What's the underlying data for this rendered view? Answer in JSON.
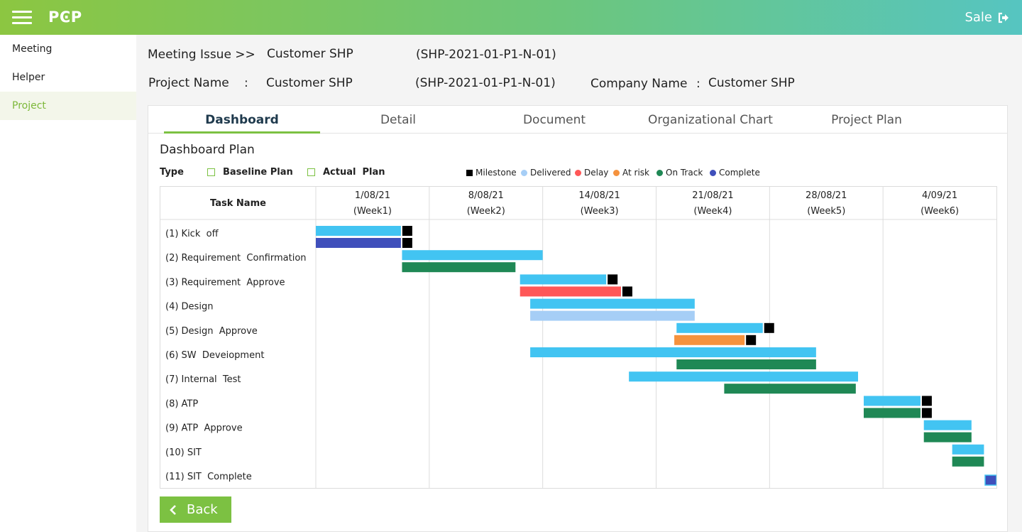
{
  "header": {
    "logo": "PϾP",
    "user_label": "Sale",
    "logout_icon": "logout-icon",
    "menu_icon": "hamburger-icon"
  },
  "sidebar": {
    "items": [
      {
        "label": "Meeting"
      },
      {
        "label": "Helper"
      },
      {
        "label": "Project",
        "active": true
      }
    ]
  },
  "meeting": {
    "prefix": "Meeting Issue >>",
    "name": "Customer SHP",
    "code": "(SHP-2021-01-P1-N-01)"
  },
  "project": {
    "label": "Project Name",
    "sep": ":",
    "name": "Customer SHP",
    "code": "(SHP-2021-01-P1-N-01)",
    "company_label": "Company Name",
    "company_sep": ":",
    "company": "Customer SHP"
  },
  "tabs": [
    {
      "label": "Dashboard",
      "active": true
    },
    {
      "label": "Detail"
    },
    {
      "label": "Document"
    },
    {
      "label": "Organizational Chart"
    },
    {
      "label": "Project Plan"
    }
  ],
  "section_title": "Dashboard Plan",
  "type_filter": {
    "label": "Type",
    "baseline": "Baseline Plan",
    "actual": "Actual  Plan"
  },
  "colors": {
    "baseline": "#42c4f2",
    "milestone": "#000000",
    "delivered": "#a6cef6",
    "delay": "#ff5757",
    "at_risk": "#f5923e",
    "on_track": "#1f8855",
    "complete": "#3f4fbb",
    "accent": "#7cc142"
  },
  "legend": [
    {
      "label": "Milestone",
      "status": "milestone",
      "shape": "square"
    },
    {
      "label": "Delivered",
      "status": "delivered",
      "shape": "dot"
    },
    {
      "label": "Delay",
      "status": "delay",
      "shape": "dot"
    },
    {
      "label": "At risk",
      "status": "at_risk",
      "shape": "dot"
    },
    {
      "label": "On Track",
      "status": "on_track",
      "shape": "dot"
    },
    {
      "label": "Complete",
      "status": "complete",
      "shape": "dot"
    }
  ],
  "chart_data": {
    "type": "gantt",
    "task_header": "Task Name",
    "weeks": [
      {
        "date": "1/08/21",
        "label": "(Week1)"
      },
      {
        "date": "8/08/21",
        "label": "(Week2)"
      },
      {
        "date": "14/08/21",
        "label": "(Week3)"
      },
      {
        "date": "21/08/21",
        "label": "(Week4)"
      },
      {
        "date": "28/08/21",
        "label": "(Week5)"
      },
      {
        "date": "4/09/21",
        "label": "(Week6)"
      }
    ],
    "tasks": [
      {
        "name": "(1) Kick  off",
        "baseline": [
          0,
          0.75
        ],
        "baseline_ms": true,
        "actual": [
          0,
          0.75
        ],
        "status": "complete",
        "actual_ms": true
      },
      {
        "name": "(2) Requirement  Confirmation",
        "baseline": [
          0.76,
          2.0
        ],
        "baseline_ms": false,
        "actual": [
          0.76,
          1.76
        ],
        "status": "on_track",
        "actual_ms": false
      },
      {
        "name": "(3) Requirement  Approve",
        "baseline": [
          1.8,
          2.56
        ],
        "baseline_ms": true,
        "actual": [
          1.8,
          2.69
        ],
        "status": "delay",
        "actual_ms": true
      },
      {
        "name": "(4) Design",
        "baseline": [
          1.89,
          3.34
        ],
        "baseline_ms": false,
        "actual": [
          1.89,
          3.34
        ],
        "status": "delivered",
        "actual_ms": false
      },
      {
        "name": "(5) Design  Approve",
        "baseline": [
          3.18,
          3.94
        ],
        "baseline_ms": true,
        "actual": [
          3.16,
          3.78
        ],
        "status": "at_risk",
        "actual_ms": true
      },
      {
        "name": "(6) SW  Deveiopment",
        "baseline": [
          1.89,
          4.41
        ],
        "baseline_ms": false,
        "actual": [
          3.18,
          4.41
        ],
        "status": "on_track",
        "actual_ms": false
      },
      {
        "name": "(7) Internal  Test",
        "baseline": [
          2.76,
          4.78
        ],
        "baseline_ms": false,
        "actual": [
          3.6,
          4.76
        ],
        "status": "on_track",
        "actual_ms": false
      },
      {
        "name": "(8) ATP",
        "baseline": [
          4.83,
          5.33
        ],
        "baseline_ms": true,
        "actual": [
          4.83,
          5.33
        ],
        "status": "on_track",
        "actual_ms": true
      },
      {
        "name": "(9) ATP  Approve",
        "baseline": [
          5.36,
          5.78
        ],
        "baseline_ms": false,
        "actual": [
          5.36,
          5.78
        ],
        "status": "on_track",
        "actual_ms": false
      },
      {
        "name": "(10) SIT",
        "baseline": [
          5.61,
          5.89
        ],
        "baseline_ms": false,
        "actual": [
          5.61,
          5.89
        ],
        "status": "on_track",
        "actual_ms": false
      },
      {
        "name": "(11) SIT  Complete",
        "baseline": null,
        "baseline_ms": false,
        "actual": [
          5.9,
          6.0
        ],
        "status": "complete",
        "actual_ms": false
      }
    ]
  },
  "back_button": {
    "label": "Back",
    "icon": "chevron-left-icon"
  }
}
